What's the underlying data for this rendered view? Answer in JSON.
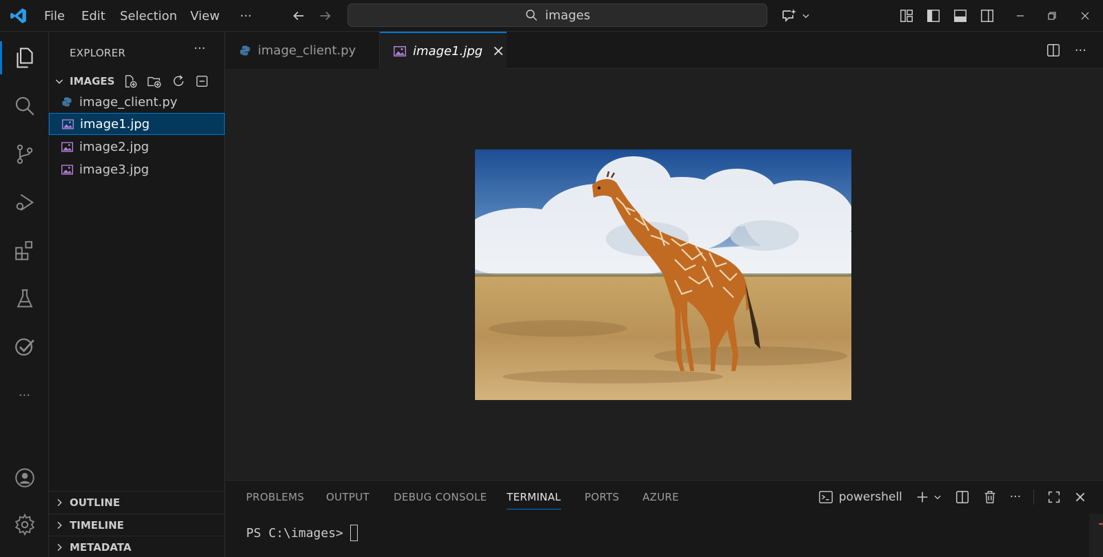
{
  "titlebar": {
    "menu": [
      "File",
      "Edit",
      "Selection",
      "View"
    ],
    "more": "···",
    "search_text": "images"
  },
  "explorer": {
    "header": "EXPLORER",
    "more": "···",
    "folder": "IMAGES",
    "files": [
      {
        "name": "image_client.py",
        "type": "python",
        "selected": false
      },
      {
        "name": "image1.jpg",
        "type": "image",
        "selected": true
      },
      {
        "name": "image2.jpg",
        "type": "image",
        "selected": false
      },
      {
        "name": "image3.jpg",
        "type": "image",
        "selected": false
      }
    ],
    "bottom_sections": [
      "OUTLINE",
      "TIMELINE",
      "METADATA"
    ]
  },
  "tabs": [
    {
      "label": "image_client.py",
      "active": false,
      "icon": "python-icon"
    },
    {
      "label": "image1.jpg",
      "active": true,
      "icon": "image-file-icon"
    }
  ],
  "panel": {
    "tabs": [
      "PROBLEMS",
      "OUTPUT",
      "DEBUG CONSOLE",
      "TERMINAL",
      "PORTS",
      "AZURE"
    ],
    "active_tab": "TERMINAL",
    "shell": "powershell",
    "more": "···",
    "prompt": "PS C:\\images>"
  },
  "colors": {
    "accent": "#0078d4",
    "selection": "#04395e",
    "background": "#1f1f1f",
    "chrome": "#181818"
  }
}
